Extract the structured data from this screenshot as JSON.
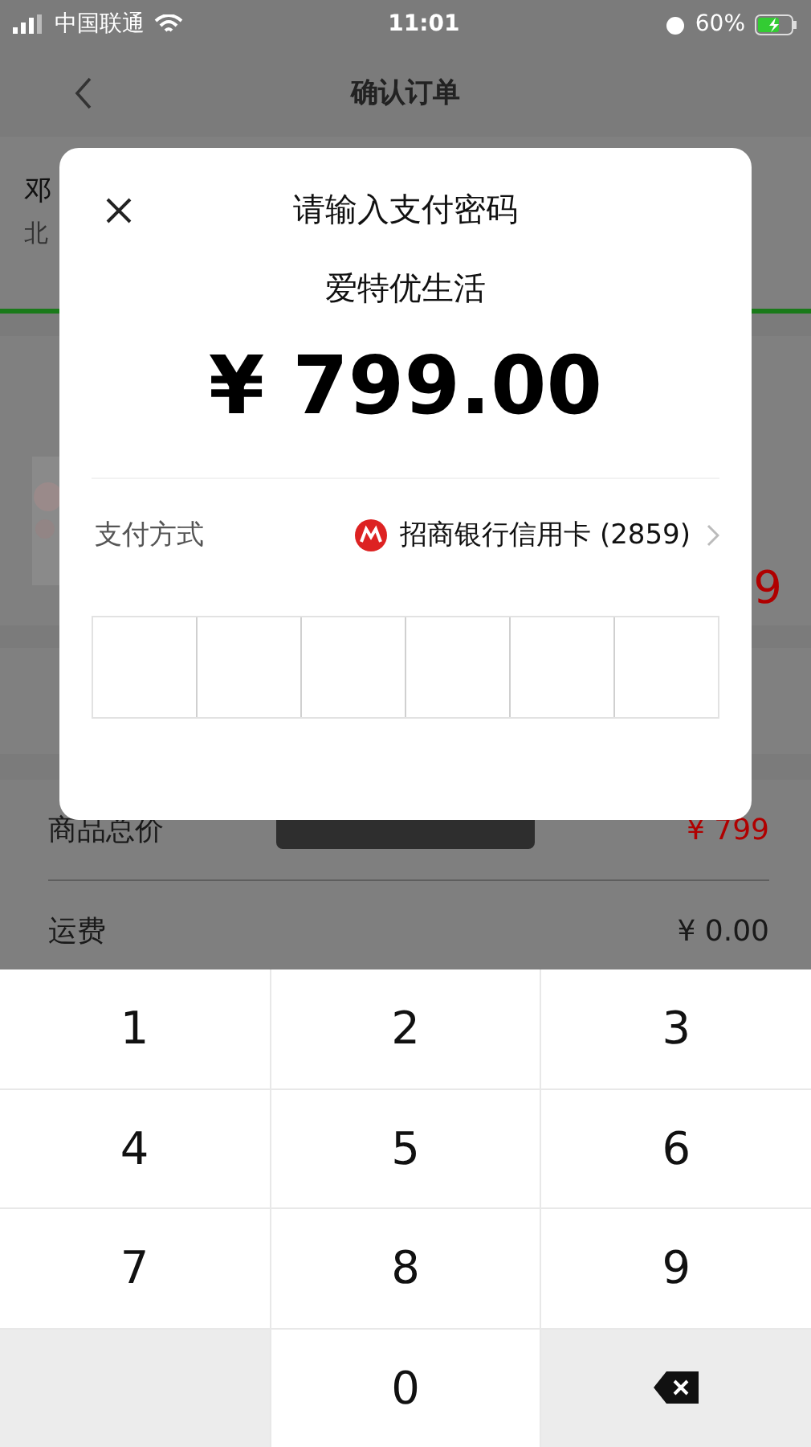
{
  "status_bar": {
    "carrier": "中国联通",
    "time": "11:01",
    "battery": "60%"
  },
  "nav": {
    "title": "确认订单"
  },
  "address": {
    "name": "邓",
    "detail": "北"
  },
  "summary": [
    {
      "label": "商品总价",
      "value": "¥ 799",
      "highlight": true
    },
    {
      "label": "运费",
      "value": "¥ 0.00",
      "highlight": false
    }
  ],
  "product": {
    "price_tail": "9"
  },
  "dialog": {
    "title": "请输入支付密码",
    "merchant": "爱特优生活",
    "amount": "¥ 799.00",
    "method_label": "支付方式",
    "method_value": "招商银行信用卡 (2859)",
    "password_cells": [
      {
        "filled": false
      },
      {
        "filled": false
      },
      {
        "filled": false
      },
      {
        "filled": false
      },
      {
        "filled": false
      },
      {
        "filled": false
      }
    ]
  },
  "keypad": [
    {
      "kind": "digit",
      "label": "1"
    },
    {
      "kind": "digit",
      "label": "2"
    },
    {
      "kind": "digit",
      "label": "3"
    },
    {
      "kind": "digit",
      "label": "4"
    },
    {
      "kind": "digit",
      "label": "5"
    },
    {
      "kind": "digit",
      "label": "6"
    },
    {
      "kind": "digit",
      "label": "7"
    },
    {
      "kind": "digit",
      "label": "8"
    },
    {
      "kind": "digit",
      "label": "9"
    },
    {
      "kind": "blank"
    },
    {
      "kind": "digit",
      "label": "0"
    },
    {
      "kind": "delete"
    }
  ]
}
